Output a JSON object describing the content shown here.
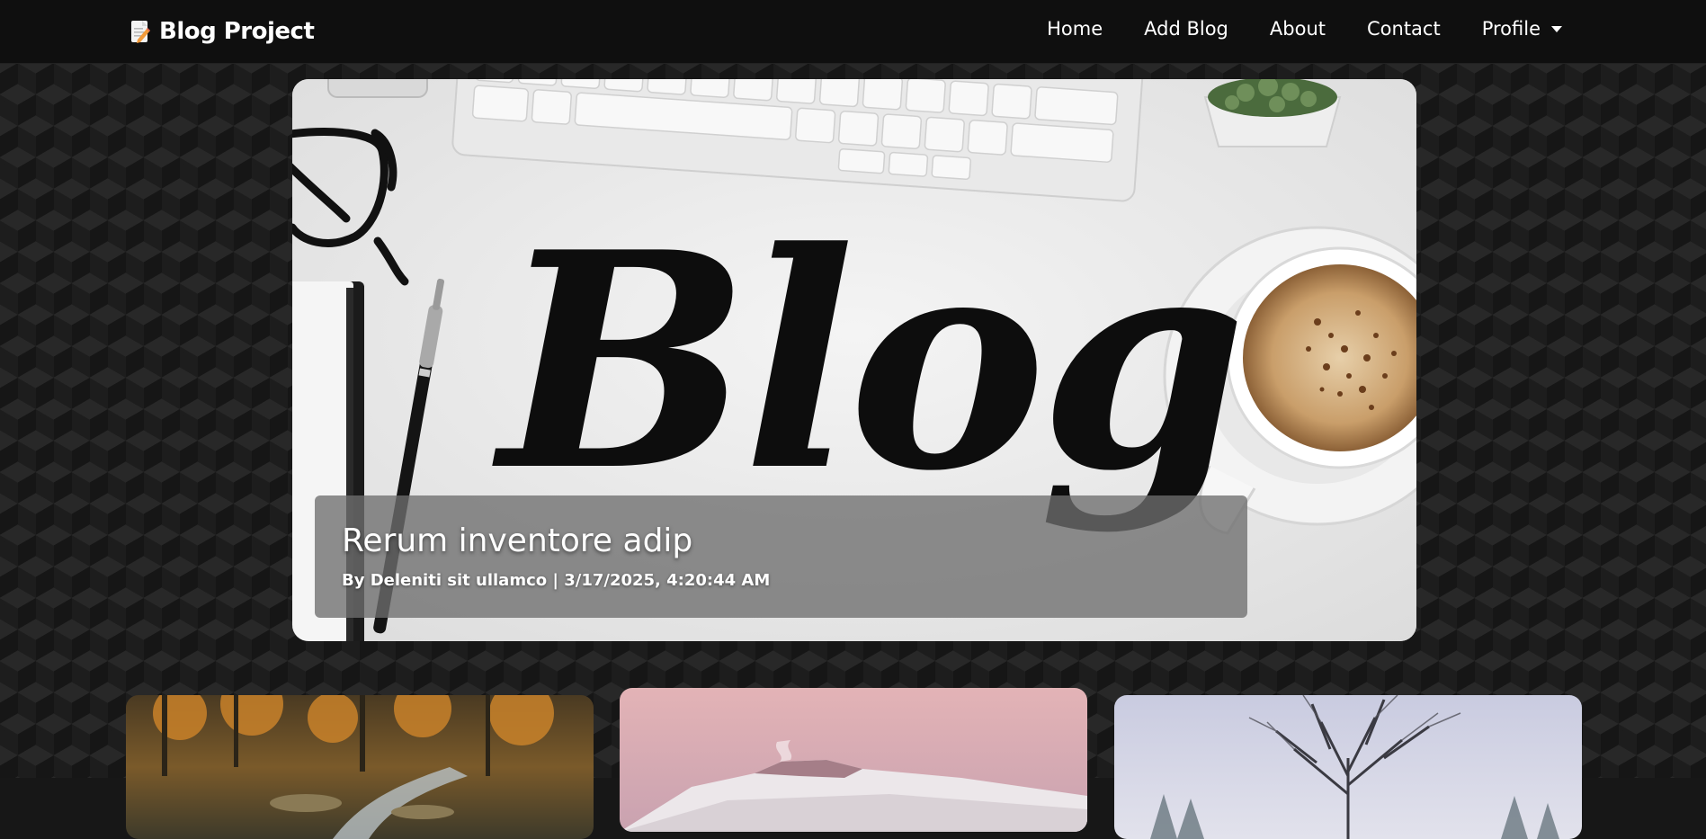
{
  "navbar": {
    "brand": "Blog Project",
    "brand_icon": "memo-icon",
    "links": [
      {
        "label": "Home"
      },
      {
        "label": "Add Blog"
      },
      {
        "label": "About"
      },
      {
        "label": "Contact"
      },
      {
        "label": "Profile"
      }
    ]
  },
  "hero": {
    "image_label": "Blog",
    "title": "Rerum inventore adip",
    "meta": "By Deleniti sit ullamco | 3/17/2025, 4:20:44 AM"
  },
  "cards": [
    {
      "image": "forest-stream"
    },
    {
      "image": "snowy-volcano"
    },
    {
      "image": "frosted-tree"
    }
  ],
  "colors": {
    "navbar_bg": "#0f0f0f",
    "page_bg": "#161616",
    "caption_bg": "rgba(110,110,110,0.78)",
    "text": "#ffffff"
  }
}
